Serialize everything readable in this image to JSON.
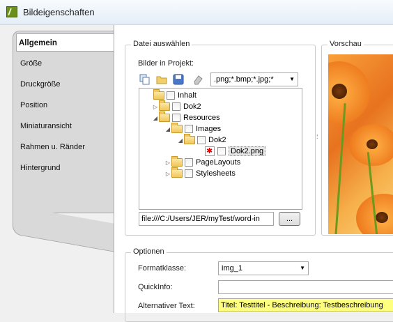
{
  "window": {
    "title": "Bildeigenschaften"
  },
  "icons": {
    "app": "app-icon",
    "copy": "copy-icon",
    "folder": "folder-icon",
    "save": "save-icon",
    "eraser": "eraser-icon",
    "image_file": "image-file-icon",
    "chevron": "chevron-down-icon"
  },
  "tabs": [
    {
      "label": "Allgemein",
      "active": true
    },
    {
      "label": "Größe"
    },
    {
      "label": "Druckgröße"
    },
    {
      "label": "Position"
    },
    {
      "label": "Miniaturansicht"
    },
    {
      "label": "Rahmen u. Ränder"
    },
    {
      "label": "Hintergrund"
    }
  ],
  "file_group": {
    "legend": "Datei auswählen",
    "images_label": "Bilder in Projekt:",
    "filter": ".png;*.bmp;*.jpg;*",
    "tree": [
      {
        "label": "Inhalt"
      },
      {
        "label": "Dok2"
      },
      {
        "label": "Resources"
      },
      {
        "label": "Images"
      },
      {
        "label": "Dok2"
      },
      {
        "label": "Dok2.png"
      },
      {
        "label": "PageLayouts"
      },
      {
        "label": "Stylesheets"
      }
    ],
    "path_value": "file:///C:/Users/JER/myTest/word-in",
    "browse_label": "..."
  },
  "preview_group": {
    "legend": "Vorschau"
  },
  "options_group": {
    "legend": "Optionen",
    "format_label": "Formatklasse:",
    "format_value": "img_1",
    "quickinfo_label": "QuickInfo:",
    "quickinfo_value": "",
    "alt_label": "Alternativer Text:",
    "alt_value": "Titel: Testtitel - Beschreibung: Testbeschreibung"
  },
  "colors": {
    "highlight": "#ffff7f",
    "tab_bg": "#d9d9d9"
  }
}
